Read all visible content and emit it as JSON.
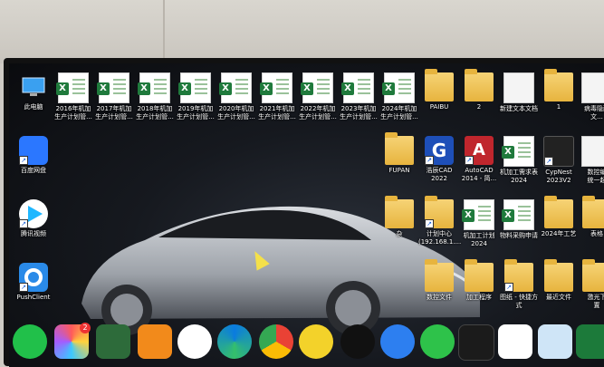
{
  "desktop": {
    "icons": [
      {
        "label": "此电脑",
        "type": "pc"
      },
      {
        "label": "2016年机加\n生产计划管...",
        "type": "excel"
      },
      {
        "label": "2017年机加\n生产计划管...",
        "type": "excel"
      },
      {
        "label": "2018年机加\n生产计划管...",
        "type": "excel"
      },
      {
        "label": "2019年机加\n生产计划管...",
        "type": "excel"
      },
      {
        "label": "2020年机加\n生产计划管...",
        "type": "excel"
      },
      {
        "label": "2021年机加\n生产计划管...",
        "type": "excel"
      },
      {
        "label": "2022年机加\n生产计划管...",
        "type": "excel"
      },
      {
        "label": "2023年机加\n生产计划管...",
        "type": "excel"
      },
      {
        "label": "2024年机加\n生产计划管...",
        "type": "excel"
      },
      {
        "label": "PAIBU",
        "type": "folder"
      },
      {
        "label": "2",
        "type": "folder"
      },
      {
        "label": "新建文本文档",
        "type": "doc"
      },
      {
        "label": "1",
        "type": "folder"
      },
      {
        "label": "病毒隐藏\n文...",
        "type": "folder"
      },
      {
        "label": "百度网盘",
        "type": "app"
      },
      {
        "label": "FUPAN",
        "type": "folder"
      },
      {
        "label": "浩辰CAD\n2022",
        "type": "app"
      },
      {
        "label": "AutoCAD\n2014 - 简...",
        "type": "app"
      },
      {
        "label": "机加工需求表\n2024",
        "type": "excel"
      },
      {
        "label": "CypNest\n2023V2",
        "type": "app"
      },
      {
        "label": "数控编\n统一起",
        "type": "doc"
      },
      {
        "label": "腾讯视频",
        "type": "app"
      },
      {
        "label": "杂",
        "type": "folder"
      },
      {
        "label": "计划中心\n(192.168.1....",
        "type": "app"
      },
      {
        "label": "机加工计划\n2024",
        "type": "excel"
      },
      {
        "label": "物料采购申请",
        "type": "excel"
      },
      {
        "label": "2024年工艺",
        "type": "folder"
      },
      {
        "label": "表格",
        "type": "folder"
      },
      {
        "label": "PushClient",
        "type": "app"
      },
      {
        "label": "数控文件",
        "type": "folder"
      },
      {
        "label": "加工程序",
        "type": "folder"
      },
      {
        "label": "图纸 - 快捷方\n式",
        "type": "folder"
      },
      {
        "label": "最近文件",
        "type": "folder"
      },
      {
        "label": "激光下\n置",
        "type": "folder"
      }
    ]
  },
  "taskbar": {
    "apps": [
      "add-app",
      "multicolor-app",
      "green-app",
      "orange-app",
      "dragon-app",
      "edge-browser",
      "chrome-browser",
      "music-app",
      "qq-app",
      "star-app",
      "wechat-app",
      "dark-app",
      "p-app",
      "recycle-app",
      "green-app-2"
    ],
    "badge": "2"
  },
  "colors": {
    "excel_green": "#1f7a3c",
    "folder_yellow": "#e7b43e",
    "baidu_blue": "#2b77ff",
    "tencent_video": "#1fb7ff",
    "pushclient_blue": "#2a8ae8",
    "haochen_blue": "#1e4fb8",
    "autocad_red": "#c0262d"
  }
}
